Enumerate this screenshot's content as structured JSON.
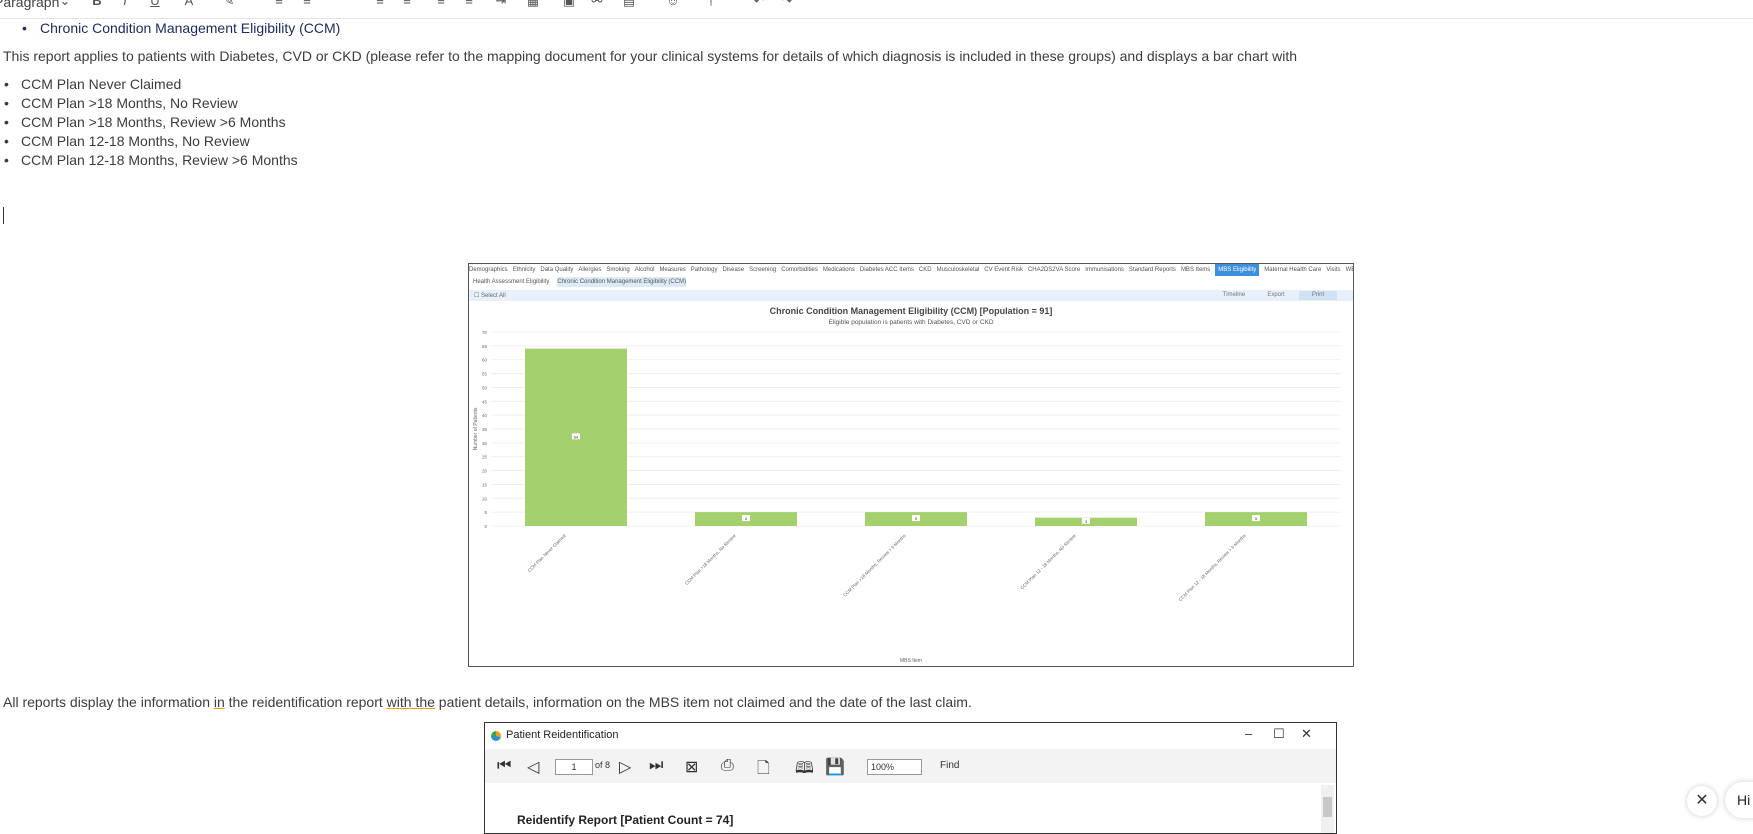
{
  "toolbar": {
    "paragraph_label": "Paragraph"
  },
  "document": {
    "ccm_heading": "Chronic Condition Management Eligibility (CCM)",
    "intro": "This report applies to patients with Diabetes, CVD or CKD (please refer to the mapping document for your clinical systems for details of which diagnosis is included in these groups) and displays a bar chart with",
    "list_items": [
      "CCM Plan Never Claimed",
      "CCM Plan >18 Months, No Review",
      "CCM Plan >18 Months, Review >6 Months",
      "CCM Plan 12-18 Months, No Review",
      "CCM Plan 12-18 Months, Review >6 Months"
    ],
    "outro_a": "All reports display the information ",
    "outro_in": "in",
    "outro_b": " the reidentification report ",
    "outro_with": "with the",
    "outro_c": " patient details, information on the MBS item not claimed and the date of the last claim."
  },
  "chart_window": {
    "tabs": [
      "Demographics",
      "Ethnicity",
      "Data Quality",
      "Allergies",
      "Smoking",
      "Alcohol",
      "Measures",
      "Pathology",
      "Disease",
      "Screening",
      "Comorbidities",
      "Medications",
      "Diabetes ACC Items",
      "CKD",
      "Musculoskeletal",
      "CV Event Risk",
      "CHA2DS2VA Score",
      "Immunisations",
      "Standard Reports",
      "MBS Items",
      "MBS Eligibility",
      "Maternal Health Care",
      "Visits",
      "WEARIT"
    ],
    "active_tab": "MBS Eligibility",
    "sub_tabs": [
      "Health Assessment Eligibility",
      "Chronic Condition Management Eligibility (CCM)"
    ],
    "select_all": "Select All",
    "buttons": [
      "Timeline",
      "Export",
      "Print"
    ]
  },
  "chart_data": {
    "type": "bar",
    "title": "Chronic Condition Management Eligibility (CCM) [Population = 91]",
    "subtitle": "Eligible population is patients with Diabetes, CVD or CKD",
    "xlabel": "MBS Item",
    "ylabel": "Number of Patients",
    "categories": [
      "CCM Plan Never Claimed",
      "CCM Plan >18 Months, No Review",
      "CCM Plan >18 Months, Review > 6 Months",
      "CCM Plan 12 - 18 Months, No Review",
      "CCM Plan 12 - 18 Months, Review > 6 Months"
    ],
    "values": [
      64,
      5,
      5,
      3,
      5
    ],
    "ylim": [
      0,
      70
    ],
    "yticks": [
      0,
      5,
      10,
      15,
      20,
      25,
      30,
      35,
      40,
      45,
      50,
      55,
      60,
      65,
      70
    ],
    "bar_color": "#a5d06e",
    "grid": true
  },
  "reid_window": {
    "title": "Patient Reidentification",
    "page": "1",
    "of_label": "of 8",
    "zoom": "100%",
    "find": "Find",
    "report_title": "Reidentify Report  [Patient Count = 74]"
  },
  "floating": {
    "hi_label": "Hi"
  }
}
